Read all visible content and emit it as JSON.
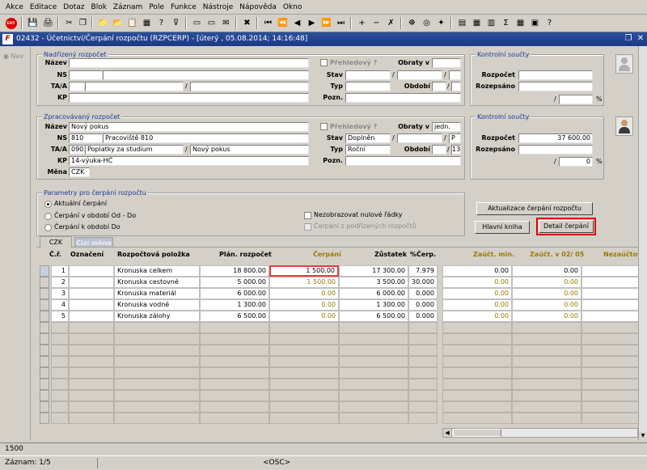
{
  "menu": [
    "Akce",
    "Editace",
    "Dotaz",
    "Blok",
    "Záznam",
    "Pole",
    "Funkce",
    "Nástroje",
    "Nápověda",
    "Okno"
  ],
  "toolbar_icons": [
    "exit-icon",
    "save-icon",
    "print-icon",
    "cut-icon",
    "copy-icon",
    "paste-icon",
    "query-icon",
    "execute-query-icon",
    "filter-icon",
    "new-record-icon",
    "delete-record-icon",
    "mail-icon",
    "close-icon",
    "first-record-icon",
    "prev-block-icon",
    "prev-record-icon",
    "next-record-icon",
    "next-block-icon",
    "last-record-icon",
    "insert-icon",
    "remove-icon",
    "clear-icon",
    "lov-icon",
    "editor-icon",
    "settings-icon",
    "calendar-icon",
    "calculator-icon",
    "sum-icon",
    "info-icon",
    "help-icon"
  ],
  "window": {
    "title": "02432 - Účetnictví/Čerpání rozpočtu (RZPCERP) - [úterý , 05.08.2014; 14:16:48]",
    "logo": "F"
  },
  "nav": "Nav",
  "nadrizeny": {
    "title": "Nadřízený rozpočet",
    "labels": {
      "nazev": "Název",
      "ns": "NS",
      "taa": "TA/A",
      "kp": "KP",
      "prehledovy": "Přehledový ?",
      "obraty": "Obraty v",
      "stav": "Stav",
      "typ": "Typ",
      "obdobi": "Období",
      "pozn": "Pozn."
    },
    "slash": "/"
  },
  "kontrol1": {
    "title": "Kontrolní součty",
    "rozpocet_label": "Rozpočet",
    "rozepsano_label": "Rozepsáno",
    "rozpocet": "",
    "rozepsano": "",
    "pct": "",
    "pct_sign": "%",
    "slash": "/"
  },
  "zpracovavany": {
    "title": "Zpracovávaný rozpočet",
    "labels": {
      "nazev": "Název",
      "ns": "NS",
      "taa": "TA/A",
      "kp": "KP",
      "mena": "Měna",
      "prehledovy": "Přehledový ?",
      "obraty": "Obraty v",
      "stav": "Stav",
      "typ": "Typ",
      "obdobi": "Období",
      "pozn": "Pozn."
    },
    "nazev": "Nový pokus",
    "ns_code": "810",
    "ns_name": "Pracoviště 810",
    "taa_code": "090",
    "taa_name": "Poplatky za studium",
    "taa_extra": "Nový pokus",
    "kp": "14-výuka-HČ",
    "mena": "CZK",
    "obraty": "jedn.",
    "stav": "Doplněn",
    "stav_code": "P",
    "typ": "Roční",
    "obdobi": "13",
    "slash": "/"
  },
  "kontrol2": {
    "title": "Kontrolní součty",
    "rozpocet_label": "Rozpočet",
    "rozepsano_label": "Rozepsáno",
    "rozpocet": "37 600.00",
    "rozepsano": "",
    "pct": "0",
    "pct_sign": "%",
    "slash": "/"
  },
  "params": {
    "title": "Parametry pro čerpání rozpočtu",
    "options": [
      "Aktuální čerpání",
      "Čerpání v období Od - Do",
      "Čerpání k období Do"
    ],
    "nezobrazovat": "Nezobrazovat nulové řádky",
    "podrizene": "Čerpání z podřízených rozpočtů"
  },
  "buttons": {
    "aktualizace": "Aktualizace čerpání rozpočtu",
    "hlavni_kniha": "Hlavní kniha",
    "detail": "Detail čerpání"
  },
  "tabs": [
    "CZK",
    "Cizí měna"
  ],
  "headers": {
    "cr": "Č.ř.",
    "oznaceni": "Označení",
    "polozka": "Rozpočtová položka",
    "plan": "Plán. rozpočet",
    "cerpani": "Čerpání",
    "zustatek": "Zůstatek",
    "pct": "%Čerp.",
    "zauct_min": "Zaúčt. min.",
    "zauct_v": "Zaúčt. v  02/ 05",
    "nezauct": "Nezaúčtová"
  },
  "rows": [
    {
      "cr": "1",
      "oznaceni": "",
      "polozka": "Kronuska celkem",
      "plan": "18 800.00",
      "cerpani": "1 500.00",
      "zustatek": "17 300.00",
      "pct": "7.979",
      "zauct_min": "0.00",
      "zauct_v": "0.00",
      "nezauct": "0."
    },
    {
      "cr": "2",
      "oznaceni": "",
      "polozka": "Kronuska cestovné",
      "plan": "5 000.00",
      "cerpani": "1 500.00",
      "zustatek": "3 500.00",
      "pct": "30.000",
      "zauct_min": "0.00",
      "zauct_v": "0.00",
      "nezauct": "0."
    },
    {
      "cr": "3",
      "oznaceni": "",
      "polozka": "Kronuska materiál",
      "plan": "6 000.00",
      "cerpani": "0.00",
      "zustatek": "6 000.00",
      "pct": "0.000",
      "zauct_min": "0.00",
      "zauct_v": "0.00",
      "nezauct": "0."
    },
    {
      "cr": "4",
      "oznaceni": "",
      "polozka": "Kronuska vodné",
      "plan": "1 300.00",
      "cerpani": "0.00",
      "zustatek": "1 300.00",
      "pct": "0.000",
      "zauct_min": "0.00",
      "zauct_v": "0.00",
      "nezauct": "0."
    },
    {
      "cr": "5",
      "oznaceni": "",
      "polozka": "Kronuska zálohy",
      "plan": "6 500.00",
      "cerpani": "0.00",
      "zustatek": "6 500.00",
      "pct": "0.000",
      "zauct_min": "0.00",
      "zauct_v": "0.00",
      "nezauct": "0."
    }
  ],
  "status": {
    "line1": "1500",
    "record": "Záznam: 1/5",
    "osc": "<OSC>"
  },
  "colors": {
    "title_bar": "#1c3a86",
    "group_title": "#1a3c9c",
    "highlight": "#e00000",
    "gold": "#9a7a00"
  }
}
